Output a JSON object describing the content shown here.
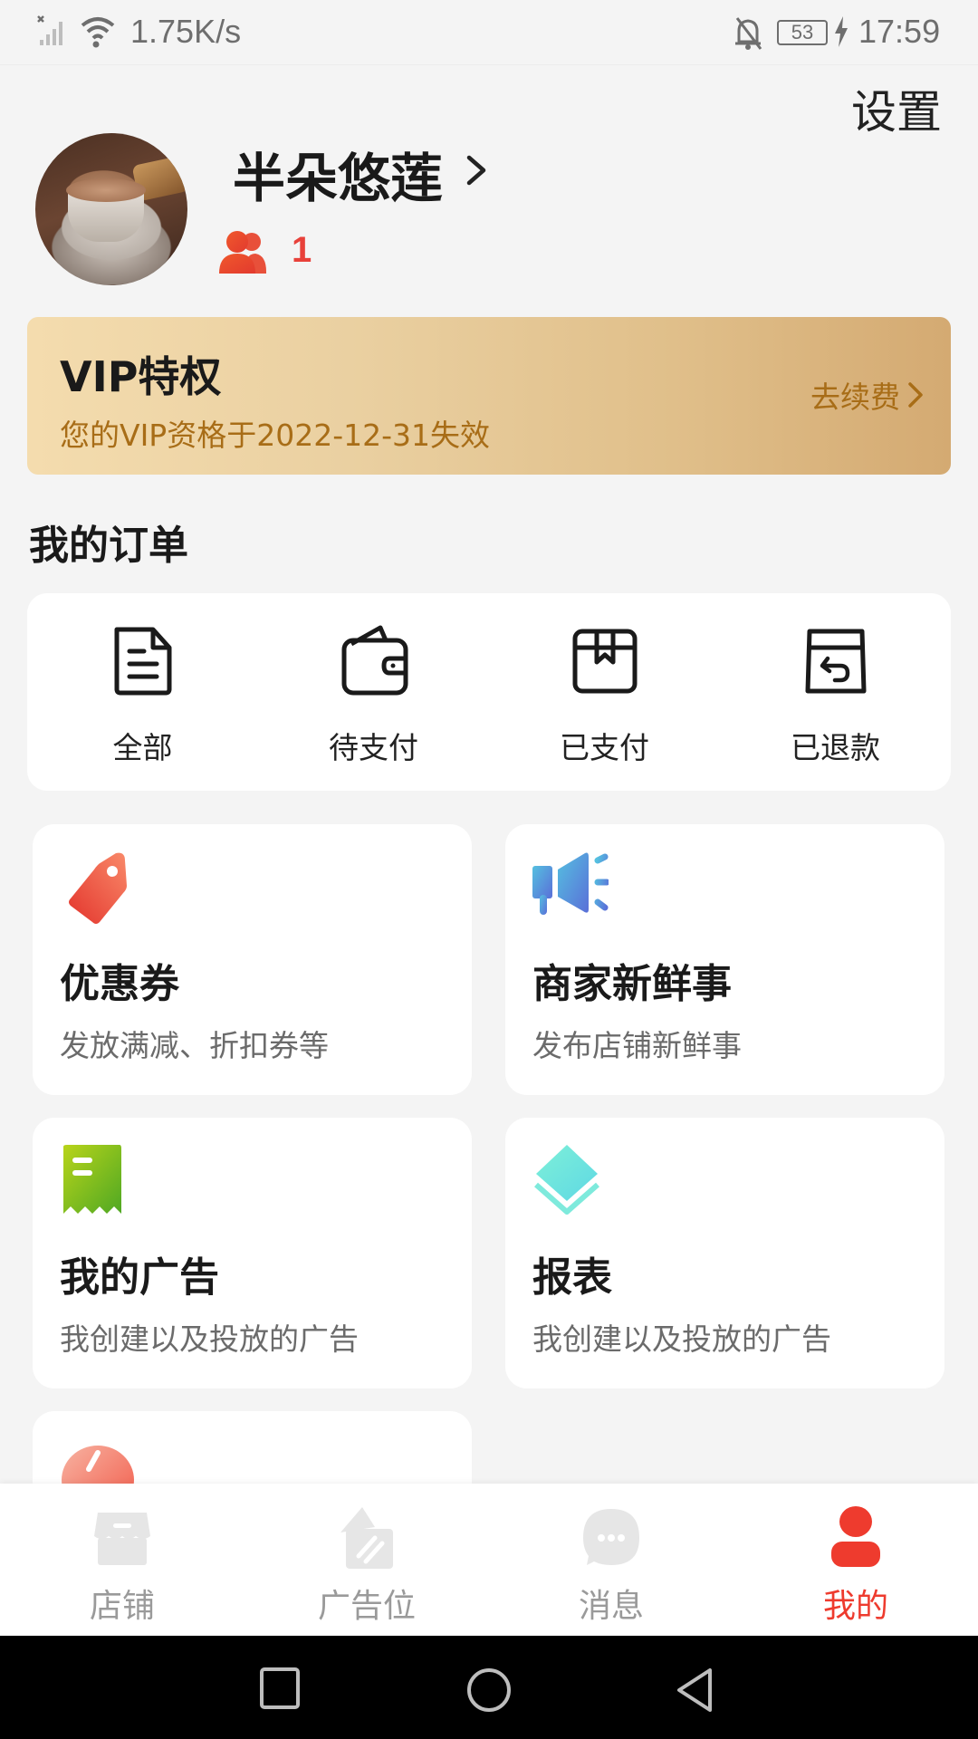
{
  "status_bar": {
    "network_speed": "1.75K/s",
    "battery_level": "53",
    "time": "17:59",
    "icons": [
      "no-sim-signal-icon",
      "wifi-icon",
      "bell-off-icon",
      "battery-icon",
      "charging-bolt-icon"
    ]
  },
  "header": {
    "settings_label": "设置",
    "username": "半朵悠莲",
    "fans_count": "1"
  },
  "vip": {
    "title": "VIP特权",
    "subtitle": "您的VIP资格于2022-12-31失效",
    "renew_label": "去续费"
  },
  "orders": {
    "title": "我的订单",
    "items": [
      {
        "label": "全部",
        "icon": "document-icon"
      },
      {
        "label": "待支付",
        "icon": "wallet-icon"
      },
      {
        "label": "已支付",
        "icon": "package-icon"
      },
      {
        "label": "已退款",
        "icon": "refund-box-icon"
      }
    ]
  },
  "features": [
    {
      "title": "优惠券",
      "subtitle": "发放满减、折扣券等",
      "icon": "coupon-tag-icon"
    },
    {
      "title": "商家新鲜事",
      "subtitle": "发布店铺新鲜事",
      "icon": "megaphone-icon"
    },
    {
      "title": "我的广告",
      "subtitle": "我创建以及投放的广告",
      "icon": "receipt-icon"
    },
    {
      "title": "报表",
      "subtitle": "我创建以及投放的广告",
      "icon": "layers-icon"
    },
    {
      "title": "",
      "subtitle": "",
      "icon": "heart-icon"
    }
  ],
  "tabs": [
    {
      "label": "店铺",
      "icon": "store-icon",
      "active": false
    },
    {
      "label": "广告位",
      "icon": "ad-slot-icon",
      "active": false
    },
    {
      "label": "消息",
      "icon": "message-icon",
      "active": false
    },
    {
      "label": "我的",
      "icon": "profile-icon",
      "active": true
    }
  ],
  "colors": {
    "accent": "#ee3b2e",
    "vip_text": "#a86d17",
    "vip_gradient_start": "#f4dcae",
    "vip_gradient_end": "#d4aa72",
    "background": "#f4f4f4"
  }
}
